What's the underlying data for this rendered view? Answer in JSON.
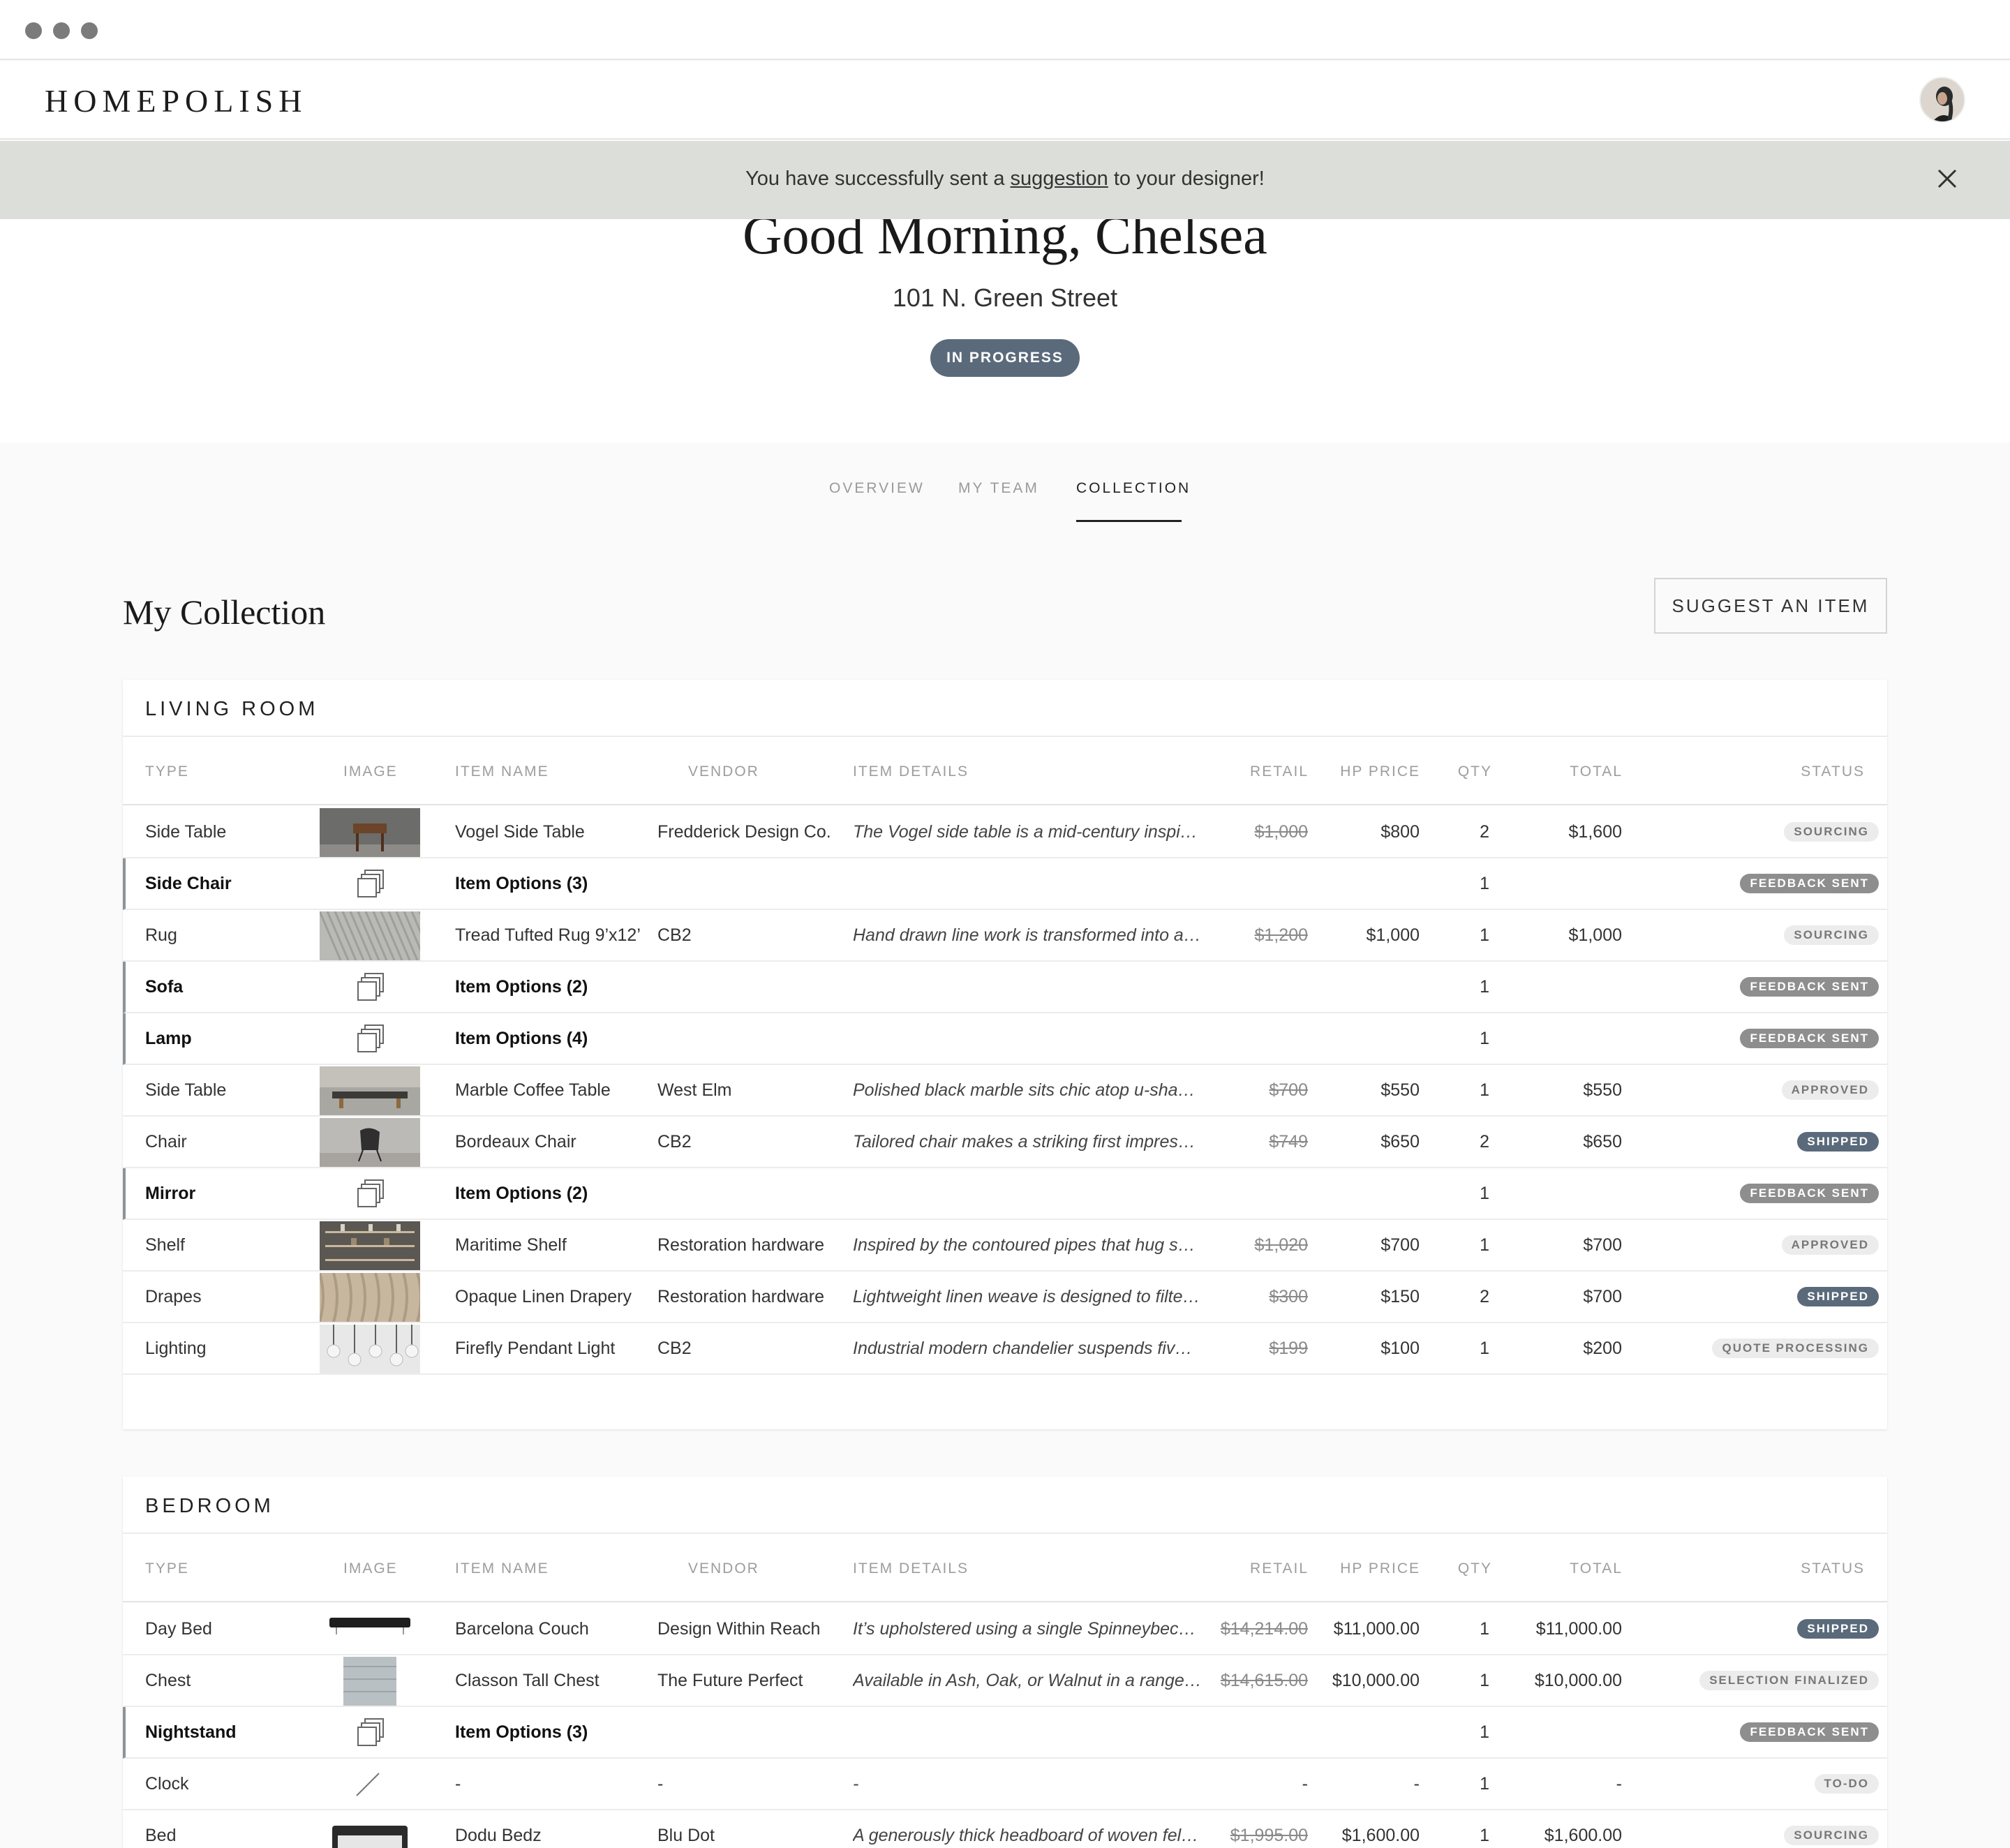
{
  "app": {
    "logo": "HOMEPOLISH"
  },
  "banner": {
    "prefix": "You have successfully sent a ",
    "link": "suggestion",
    "suffix": " to your designer!"
  },
  "hero": {
    "greeting": "Good Morning, Chelsea",
    "address": "101 N. Green Street",
    "status": "IN PROGRESS"
  },
  "tabs": [
    "OVERVIEW",
    "MY TEAM",
    "COLLECTION"
  ],
  "active_tab": "COLLECTION",
  "collection": {
    "title": "My Collection",
    "suggest_label": "SUGGEST AN ITEM"
  },
  "columns": [
    "TYPE",
    "IMAGE",
    "ITEM NAME",
    "VENDOR",
    "ITEM DETAILS",
    "RETAIL",
    "HP PRICE",
    "QTY",
    "TOTAL",
    "STATUS"
  ],
  "colors": {
    "slate": "#5a6a7b",
    "banner": "#dcdfd9",
    "badge_gray": "#8e8e8e"
  },
  "rooms": [
    {
      "name": "LIVING ROOM",
      "rows": [
        {
          "type": "Side Table",
          "image": "side-table-photo",
          "name": "Vogel Side Table",
          "vendor": "Fredderick Design Co.",
          "details": "The Vogel side table is a mid-century inspir…",
          "retail": "$1,000",
          "hp": "$800",
          "qty": "2",
          "total": "$1,600",
          "status": "SOURCING",
          "tone": "light",
          "options": false
        },
        {
          "type": "Side Chair",
          "image": "item-options-icon",
          "name": "Item Options (3)",
          "vendor": "",
          "details": "",
          "retail": "",
          "hp": "",
          "qty": "1",
          "total": "",
          "status": "FEEDBACK SENT",
          "tone": "dark",
          "options": true
        },
        {
          "type": "Rug",
          "image": "rug-photo",
          "name": "Tread Tufted Rug 9’x12’",
          "vendor": "CB2",
          "details": "Hand drawn line work is transformed into a…",
          "retail": "$1,200",
          "hp": "$1,000",
          "qty": "1",
          "total": "$1,000",
          "status": "SOURCING",
          "tone": "light",
          "options": false
        },
        {
          "type": "Sofa",
          "image": "item-options-icon",
          "name": "Item Options (2)",
          "vendor": "",
          "details": "",
          "retail": "",
          "hp": "",
          "qty": "1",
          "total": "",
          "status": "FEEDBACK SENT",
          "tone": "dark",
          "options": true
        },
        {
          "type": "Lamp",
          "image": "item-options-icon",
          "name": "Item Options (4)",
          "vendor": "",
          "details": "",
          "retail": "",
          "hp": "",
          "qty": "1",
          "total": "",
          "status": "FEEDBACK SENT",
          "tone": "dark",
          "options": true
        },
        {
          "type": "Side Table",
          "image": "coffee-table-photo",
          "name": "Marble Coffee Table",
          "vendor": "West Elm",
          "details": "Polished black marble sits chic  atop u-shap…",
          "retail": "$700",
          "hp": "$550",
          "qty": "1",
          "total": "$550",
          "status": "APPROVED",
          "tone": "light",
          "options": false
        },
        {
          "type": "Chair",
          "image": "chair-photo",
          "name": "Bordeaux Chair",
          "vendor": "CB2",
          "details": "Tailored chair makes a striking first impressi…",
          "retail": "$749",
          "hp": "$650",
          "qty": "2",
          "total": "$650",
          "status": "SHIPPED",
          "tone": "slate",
          "options": false
        },
        {
          "type": "Mirror",
          "image": "item-options-icon",
          "name": "Item Options (2)",
          "vendor": "",
          "details": "",
          "retail": "",
          "hp": "",
          "qty": "1",
          "total": "",
          "status": "FEEDBACK SENT",
          "tone": "dark",
          "options": true
        },
        {
          "type": "Shelf",
          "image": "shelf-photo",
          "name": "Maritime Shelf",
          "vendor": "Restoration hardware",
          "details": "Inspired by the contoured pipes that hug s…",
          "retail": "$1,020",
          "hp": "$700",
          "qty": "1",
          "total": "$700",
          "status": "APPROVED",
          "tone": "light",
          "options": false
        },
        {
          "type": "Drapes",
          "image": "drapes-photo",
          "name": "Opaque Linen Drapery",
          "vendor": "Restoration hardware",
          "details": "Lightweight linen weave is designed to filte…",
          "retail": "$300",
          "hp": "$150",
          "qty": "2",
          "total": "$700",
          "status": "SHIPPED",
          "tone": "slate",
          "options": false
        },
        {
          "type": "Lighting",
          "image": "pendant-photo",
          "name": "Firefly Pendant Light",
          "vendor": "CB2",
          "details": "Industrial modern chandelier suspends five…",
          "retail": "$199",
          "hp": "$100",
          "qty": "1",
          "total": "$200",
          "status": "QUOTE PROCESSING",
          "tone": "light",
          "options": false
        }
      ]
    },
    {
      "name": "BEDROOM",
      "rows": [
        {
          "type": "Day Bed",
          "image": "daybed-photo",
          "name": "Barcelona Couch",
          "vendor": "Design Within Reach",
          "details": "It’s upholstered using a single Spinneybeck…",
          "retail": "$14,214.00",
          "hp": "$11,000.00",
          "qty": "1",
          "total": "$11,000.00",
          "status": "SHIPPED",
          "tone": "slate",
          "options": false
        },
        {
          "type": "Chest",
          "image": "chest-photo",
          "name": "Classon Tall Chest",
          "vendor": "The Future Perfect",
          "details": "Available in Ash, Oak, or Walnut in a range…",
          "retail": "$14,615.00",
          "hp": "$10,000.00",
          "qty": "1",
          "total": "$10,000.00",
          "status": "SELECTION FINALIZED",
          "tone": "light",
          "options": false
        },
        {
          "type": "Nightstand",
          "image": "item-options-icon",
          "name": "Item Options (3)",
          "vendor": "",
          "details": "",
          "retail": "",
          "hp": "",
          "qty": "1",
          "total": "",
          "status": "FEEDBACK SENT",
          "tone": "dark",
          "options": true
        },
        {
          "type": "Clock",
          "image": "no-image-icon",
          "name": "-",
          "vendor": "-",
          "details": "-",
          "retail": "",
          "hp": "-",
          "qty": "1",
          "total": "-",
          "status": "TO-DO",
          "tone": "light",
          "options": false,
          "retail_dash": "-"
        },
        {
          "type": "Bed",
          "image": "bed-photo",
          "name": "Dodu Bedz",
          "vendor": "Blu Dot",
          "details": "A generously thick headboard of woven felt…",
          "retail": "$1,995.00",
          "hp": "$1,600.00",
          "qty": "1",
          "total": "$1,600.00",
          "status": "SOURCING",
          "tone": "light",
          "options": false
        }
      ]
    }
  ]
}
